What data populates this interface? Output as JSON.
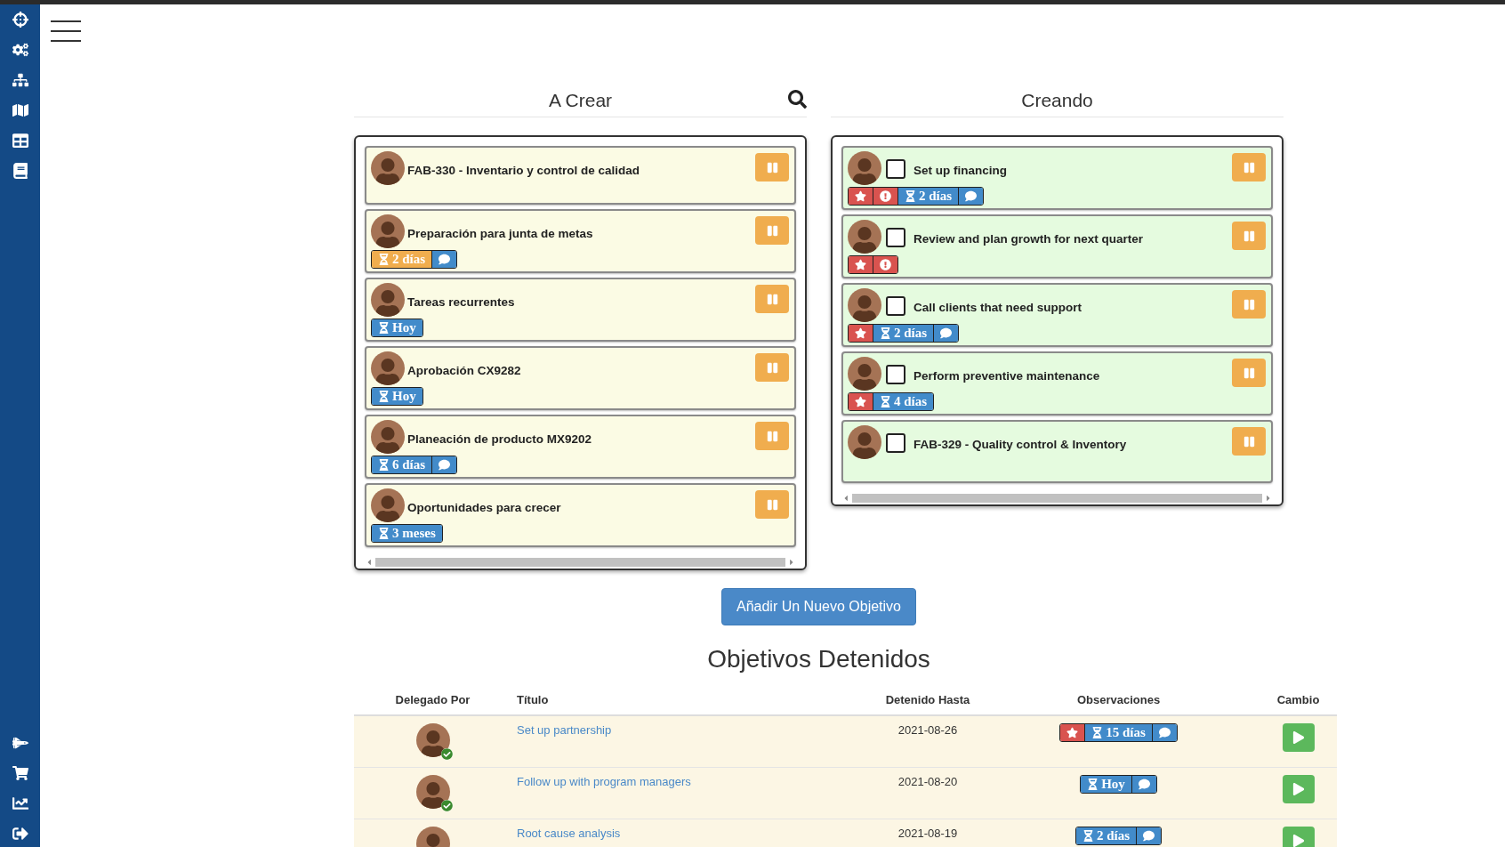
{
  "columns": [
    {
      "title": "A Crear",
      "search": true,
      "color": "#fbfbe4",
      "cards": [
        {
          "title": "FAB-330 - Inventario y control de calidad"
        },
        {
          "title": "Preparación para junta de metas",
          "badges": [
            {
              "kind": "time",
              "text": "2 días",
              "color": "#f0ad4e"
            },
            {
              "kind": "comment",
              "color": "#428bca"
            }
          ]
        },
        {
          "title": "Tareas recurrentes",
          "badges": [
            {
              "kind": "time",
              "text": "Hoy",
              "color": "#428bca"
            }
          ]
        },
        {
          "title": "Aprobación CX9282",
          "badges": [
            {
              "kind": "time",
              "text": "Hoy",
              "color": "#428bca"
            }
          ]
        },
        {
          "title": "Planeación de producto MX9202",
          "badges": [
            {
              "kind": "time",
              "text": "6 días",
              "color": "#428bca"
            },
            {
              "kind": "comment",
              "color": "#428bca"
            }
          ]
        },
        {
          "title": "Oportunidades para crecer",
          "badges": [
            {
              "kind": "time",
              "text": "3 meses",
              "color": "#428bca"
            }
          ]
        }
      ]
    },
    {
      "title": "Creando",
      "color": "#e5fbdf",
      "cards": [
        {
          "title": "Set up financing",
          "checked": false,
          "badges": [
            {
              "kind": "star",
              "color": "#d9534f"
            },
            {
              "kind": "alert",
              "color": "#d9534f"
            },
            {
              "kind": "time",
              "text": "2 días",
              "color": "#428bca"
            },
            {
              "kind": "comment",
              "color": "#428bca"
            }
          ]
        },
        {
          "title": "Review and plan growth for next quarter",
          "checked": false,
          "badges": [
            {
              "kind": "star",
              "color": "#d9534f"
            },
            {
              "kind": "alert",
              "color": "#d9534f"
            }
          ]
        },
        {
          "title": "Call clients that need support",
          "checked": false,
          "badges": [
            {
              "kind": "star",
              "color": "#d9534f"
            },
            {
              "kind": "time",
              "text": "2 días",
              "color": "#428bca"
            },
            {
              "kind": "comment",
              "color": "#428bca"
            }
          ]
        },
        {
          "title": "Perform preventive maintenance",
          "checked": false,
          "badges": [
            {
              "kind": "star",
              "color": "#d9534f"
            },
            {
              "kind": "time",
              "text": "4 días",
              "color": "#428bca"
            }
          ]
        },
        {
          "title": "FAB-329 - Quality control & Inventory",
          "checked": false
        }
      ]
    }
  ],
  "add_button": "Añadir Un Nuevo Objetivo",
  "stopped": {
    "title": "Objetivos Detenidos",
    "columns": [
      "Delegado Por",
      "Título",
      "Detenido Hasta",
      "Observaciones",
      "Cambio"
    ],
    "rows": [
      {
        "verified": true,
        "title": "Set up partnership",
        "until": "2021-08-26",
        "badges": [
          {
            "kind": "star",
            "color": "#d9534f"
          },
          {
            "kind": "time",
            "text": "15 días",
            "color": "#428bca"
          },
          {
            "kind": "comment",
            "color": "#428bca"
          }
        ]
      },
      {
        "verified": true,
        "title": "Follow up with program managers",
        "until": "2021-08-20",
        "badges": [
          {
            "kind": "time",
            "text": "Hoy",
            "color": "#428bca"
          },
          {
            "kind": "comment",
            "color": "#428bca"
          }
        ]
      },
      {
        "title": "Root cause analysis",
        "until": "2021-08-19",
        "badges": [
          {
            "kind": "time",
            "text": "2 días",
            "color": "#428bca"
          },
          {
            "kind": "comment",
            "color": "#428bca"
          }
        ]
      }
    ]
  }
}
